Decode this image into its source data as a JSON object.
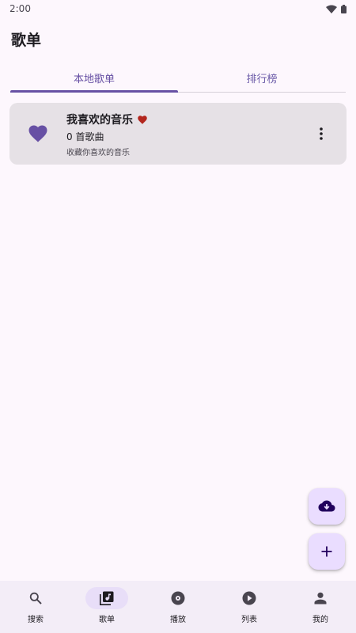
{
  "status_bar": {
    "time": "2:00"
  },
  "page": {
    "title": "歌单"
  },
  "tabs": [
    {
      "label": "本地歌单",
      "active": true
    },
    {
      "label": "排行榜",
      "active": false
    }
  ],
  "playlist": {
    "title": "我喜欢的音乐",
    "count": "0 首歌曲",
    "description": "收藏你喜欢的音乐",
    "icon": "heart-icon"
  },
  "fabs": {
    "cloud_icon": "cloud-download-icon",
    "add_icon": "add-icon"
  },
  "bottom_nav": [
    {
      "label": "搜索",
      "icon": "search-icon"
    },
    {
      "label": "歌单",
      "icon": "playlist-icon",
      "active": true
    },
    {
      "label": "播放",
      "icon": "disc-icon"
    },
    {
      "label": "列表",
      "icon": "play-circle-icon"
    },
    {
      "label": "我的",
      "icon": "person-icon"
    }
  ],
  "colors": {
    "accent": "#6750a4",
    "heart_red": "#b3261e",
    "card_bg": "#e6e1e6",
    "fab_bg": "#eaddff",
    "nav_bg": "#f3edf7"
  }
}
